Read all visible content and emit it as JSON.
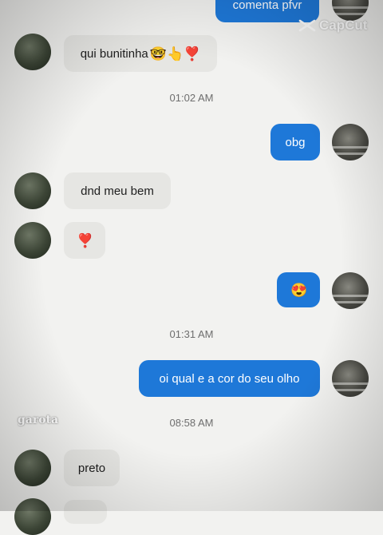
{
  "watermark": {
    "text": "CapCut"
  },
  "sticker": {
    "text": "garota"
  },
  "messages": {
    "m0": {
      "text": "comenta pfvr"
    },
    "m1": {
      "text": "qui bunitinha",
      "emoji": "🤓👆❣️"
    },
    "t1": {
      "text": "01:02 AM"
    },
    "m2": {
      "text": "obg"
    },
    "m3": {
      "text": "dnd meu bem"
    },
    "m4": {
      "emoji": "❣️"
    },
    "m5": {
      "emoji": "😍"
    },
    "t2": {
      "text": "01:31 AM"
    },
    "m6": {
      "text": "oi qual e a cor do seu olho"
    },
    "t3": {
      "text": "08:58 AM"
    },
    "m7": {
      "text": "preto"
    }
  },
  "colors": {
    "outgoing": "#1e78d8",
    "incoming": "#e6e6e3",
    "background": "#f2f2f0"
  }
}
